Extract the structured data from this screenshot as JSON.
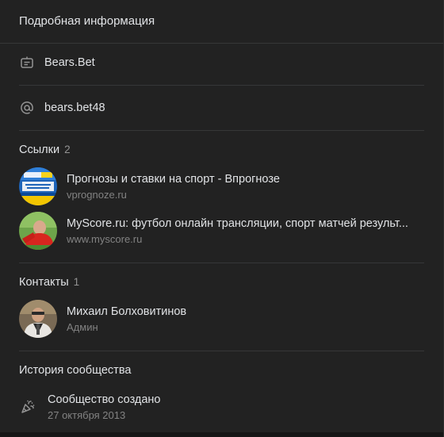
{
  "header": {
    "title": "Подробная информация"
  },
  "info": {
    "name": "Bears.Bet",
    "name_icon": "card-icon",
    "domain": "bears.bet48",
    "domain_icon": "at-icon"
  },
  "links": {
    "title": "Ссылки",
    "count": "2",
    "items": [
      {
        "title": "Прогнозы и ставки на спорт - Впрогнозе",
        "subtitle": "vprognoze.ru"
      },
      {
        "title": "MyScore.ru: футбол онлайн трансляции, спорт матчей результ...",
        "subtitle": "www.myscore.ru"
      }
    ]
  },
  "contacts": {
    "title": "Контакты",
    "count": "1",
    "items": [
      {
        "name": "Михаил Болховитинов",
        "role": "Админ"
      }
    ]
  },
  "history": {
    "title": "История сообщества",
    "event_title": "Сообщество создано",
    "event_date": "27 октября 2013",
    "event_icon": "party-popper-icon"
  },
  "colors": {
    "background": "#222222",
    "text_primary": "#e1e3e6",
    "text_secondary": "#828282",
    "divider": "#363738"
  }
}
